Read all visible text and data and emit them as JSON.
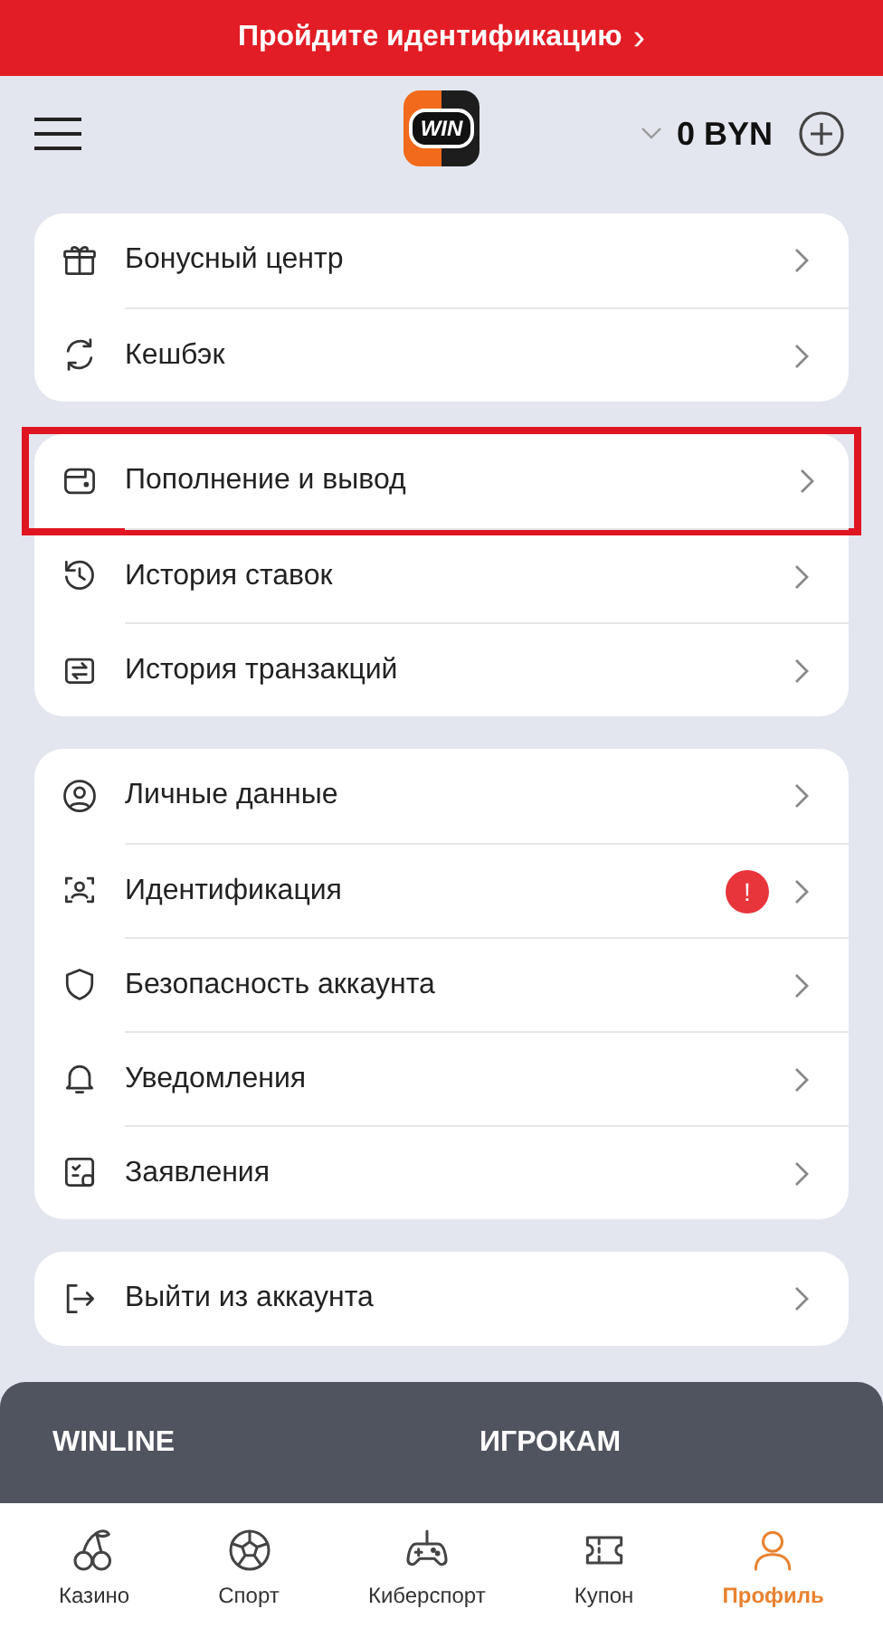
{
  "banner": {
    "text": "Пройдите идентификацию",
    "arrow": "›"
  },
  "header": {
    "logo": "WIN",
    "balance": "0 BYN"
  },
  "sections": [
    {
      "items": [
        {
          "label": "Бонусный центр",
          "highlighted": false
        },
        {
          "label": "Кешбэк",
          "highlighted": false
        }
      ]
    },
    {
      "items": [
        {
          "label": "Пополнение и вывод",
          "highlighted": true
        },
        {
          "label": "История ставок",
          "highlighted": false
        },
        {
          "label": "История транзакций",
          "highlighted": false
        }
      ]
    },
    {
      "items": [
        {
          "label": "Личные данные",
          "highlighted": false
        },
        {
          "label": "Идентификация",
          "highlighted": false,
          "badge": "!"
        },
        {
          "label": "Безопасность аккаунта",
          "highlighted": false
        },
        {
          "label": "Уведомления",
          "highlighted": false
        },
        {
          "label": "Заявления",
          "highlighted": false
        }
      ]
    },
    {
      "items": [
        {
          "label": "Выйти из аккаунта",
          "highlighted": false
        }
      ]
    }
  ],
  "footer": {
    "columns": [
      "WINLINE",
      "ИГРОКАМ"
    ]
  },
  "bottom_nav": [
    {
      "label": "Казино",
      "selected": false
    },
    {
      "label": "Спорт",
      "selected": false
    },
    {
      "label": "Киберспорт",
      "selected": false
    },
    {
      "label": "Купон",
      "selected": false
    },
    {
      "label": "Профиль",
      "selected": true
    }
  ]
}
